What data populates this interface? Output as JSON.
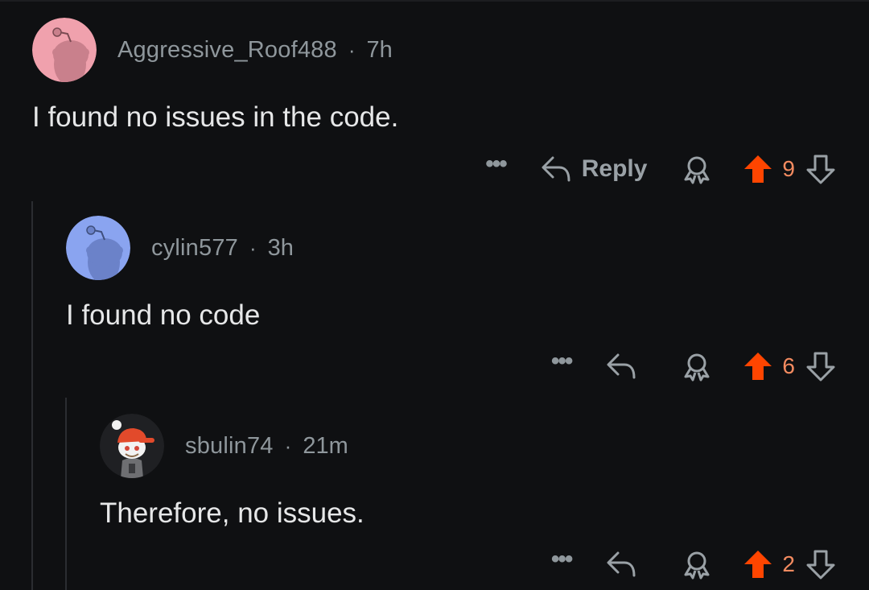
{
  "colors": {
    "background": "#0f1012",
    "upvote": "#ff4500",
    "score": "#f48b60",
    "muted": "#8f979c",
    "text": "#e6e7e8"
  },
  "comments": [
    {
      "username": "Aggressive_Roof488",
      "time": "7h",
      "body": "I found no issues in the code.",
      "reply_label": "Reply",
      "score": "9",
      "avatar": "pink-snoo-avatar"
    },
    {
      "username": "cylin577",
      "time": "3h",
      "body": "I found no code",
      "reply_label": "",
      "score": "6",
      "avatar": "blue-snoo-avatar"
    },
    {
      "username": "sbulin74",
      "time": "21m",
      "body": "Therefore, no issues.",
      "reply_label": "",
      "score": "2",
      "avatar": "custom-snoo-red-cap-avatar"
    }
  ],
  "separator": "·",
  "more_label": "•••",
  "icons": [
    "reply-arrow-icon",
    "award-icon",
    "upvote-icon",
    "downvote-icon",
    "more-icon"
  ]
}
